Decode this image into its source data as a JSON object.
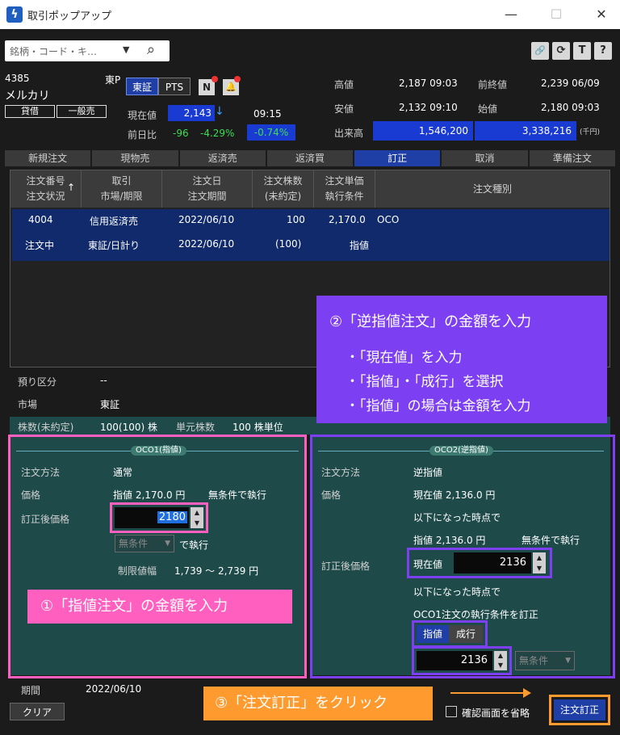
{
  "window": {
    "title": "取引ポップアップ",
    "logo_glyph": "ϟ",
    "min": "—",
    "max": "☐",
    "close": "✕"
  },
  "toolbar": {
    "search_placeholder": "銘柄・コード・キ…",
    "dropdown_glyph": "▼",
    "search_glyph": "⌕",
    "btn_link": "🔗",
    "btn_refresh": "⟳",
    "btn_t": "T",
    "btn_help": "?"
  },
  "stock": {
    "code": "4385",
    "market_short": "東P",
    "name": "メルカリ",
    "badge_loan": "貸借",
    "badge_general": "一般売",
    "exchange_tokyo": "東証",
    "exchange_pts": "PTS",
    "btn_n": "N",
    "btn_bell": "🔔",
    "current_label": "現在値",
    "current_value": "2,143",
    "current_arrow": "↓",
    "current_time": "09:15",
    "prev_label": "前日比",
    "prev_diff": "-96",
    "prev_pct": "-4.29%",
    "prev_pct_box": "-0.74%"
  },
  "quote": {
    "high_label": "高値",
    "high_value": "2,187 09:03",
    "prevclose_label": "前終値",
    "prevclose_value": "2,239 06/09",
    "low_label": "安値",
    "low_value": "2,132 09:10",
    "open_label": "始値",
    "open_value": "2,180 09:03",
    "volume_label": "出来高",
    "volume_value": "1,546,200",
    "volume_value2": "3,338,216",
    "volume_unit": "(千円)"
  },
  "tabs": [
    "新規注文",
    "現物売",
    "返済売",
    "返済買",
    "訂正",
    "取消",
    "準備注文"
  ],
  "table": {
    "headers": [
      {
        "l1": "注文番号",
        "l2": "注文状況"
      },
      {
        "l1": "取引",
        "l2": "市場/期限"
      },
      {
        "l1": "注文日",
        "l2": "注文期間"
      },
      {
        "l1": "注文株数",
        "l2": "(未約定)"
      },
      {
        "l1": "注文単価",
        "l2": "執行条件"
      },
      {
        "l1": "注文種別",
        "l2": ""
      }
    ],
    "sort_glyph": "↑",
    "row": {
      "order_no": "4004",
      "status": "注文中",
      "trade": "信用返済売",
      "market": "東証/日計り",
      "date": "2022/06/10",
      "period": "2022/06/10",
      "qty": "100",
      "unfilled": "(100)",
      "price": "2,170.0",
      "condition": "指値",
      "type": "OCO"
    }
  },
  "info": {
    "deposit_label": "預り区分",
    "deposit_value": "--",
    "market_label": "市場",
    "market_value": "東証",
    "shares_label": "株数(未約定)",
    "shares_value": "100(100) 株",
    "unit_label": "単元株数",
    "unit_value": "100 株単位"
  },
  "oco1": {
    "badge": "OCO1(指値)",
    "method_label": "注文方法",
    "method_value": "通常",
    "price_label": "価格",
    "price_value": "指値 2,170.0 円",
    "price_cond": "無条件で執行",
    "revised_label": "訂正後価格",
    "revised_value": "2180",
    "cond_select": "無条件",
    "cond_suffix": "で執行",
    "limit_label": "制限値幅",
    "limit_value": "1,739 〜 2,739 円"
  },
  "oco2": {
    "badge": "OCO2(逆指値)",
    "method_label": "注文方法",
    "method_value": "逆指値",
    "price_label": "価格",
    "price_value": "現在値 2,136.0 円",
    "price_line2": "以下になった時点で",
    "price_line3": "指値 2,136.0 円",
    "price_line3_cond": "無条件で執行",
    "revised_label": "訂正後価格",
    "trigger_prefix": "現在値",
    "trigger_value": "2136",
    "trigger_line": "以下になった時点で",
    "oco_line": "OCO1注文の執行条件を訂正",
    "toggle_limit": "指値",
    "toggle_market": "成行",
    "limit_value": "2136",
    "cond_select": "無条件"
  },
  "bottom": {
    "period_label": "期間",
    "period_value": "2022/06/10",
    "clear_button": "クリア",
    "skip_confirm": "確認画面を省略",
    "submit_button": "注文訂正"
  },
  "annotations": {
    "step1": "①「指値注文」の金額を入力",
    "step2_title": "②「逆指値注文」の金額を入力",
    "step2_items": [
      "・「現在値」を入力",
      "・「指値」・「成行」を選択",
      "・「指値」の場合は金額を入力"
    ],
    "step3": "③「注文訂正」をクリック"
  },
  "colors": {
    "pink": "#ff5fbf",
    "purple": "#7d3ff2",
    "orange": "#ff9a2e",
    "panel": "#1f4a4a",
    "active_tab": "#1f3fa6"
  }
}
